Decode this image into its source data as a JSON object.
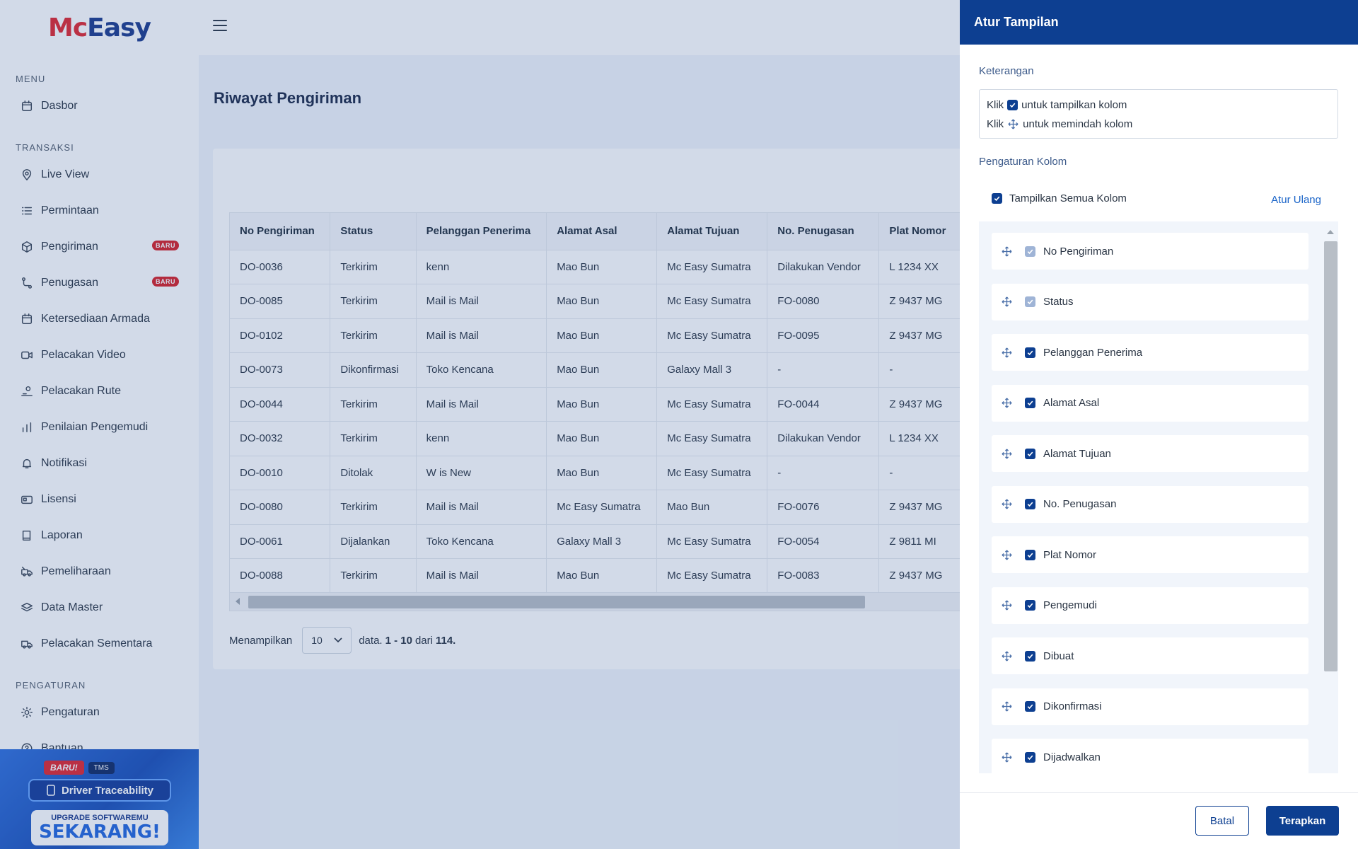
{
  "brand": {
    "logo_red": "Mc",
    "logo_blue": "Easy"
  },
  "sidebar": {
    "sections": [
      {
        "heading": "MENU",
        "items": [
          {
            "label": "Dasbor",
            "icon": "calendar-icon"
          }
        ]
      },
      {
        "heading": "TRANSAKSI",
        "items": [
          {
            "label": "Live View",
            "icon": "location-pin-icon"
          },
          {
            "label": "Permintaan",
            "icon": "list-icon"
          },
          {
            "label": "Pengiriman",
            "icon": "package-icon",
            "badge": "BARU"
          },
          {
            "label": "Penugasan",
            "icon": "route-icon",
            "badge": "BARU"
          },
          {
            "label": "Ketersediaan Armada",
            "icon": "calendar-icon"
          },
          {
            "label": "Pelacakan Video",
            "icon": "video-icon"
          },
          {
            "label": "Pelacakan Rute",
            "icon": "route-person-icon"
          },
          {
            "label": "Penilaian Pengemudi",
            "icon": "bar-chart-icon"
          },
          {
            "label": "Notifikasi",
            "icon": "bell-icon"
          },
          {
            "label": "Lisensi",
            "icon": "license-icon"
          },
          {
            "label": "Laporan",
            "icon": "book-icon"
          },
          {
            "label": "Pemeliharaan",
            "icon": "truck-wrench-icon"
          },
          {
            "label": "Data Master",
            "icon": "layers-icon"
          },
          {
            "label": "Pelacakan Sementara",
            "icon": "truck-icon"
          }
        ]
      },
      {
        "heading": "PENGATURAN",
        "items": [
          {
            "label": "Pengaturan",
            "icon": "gear-icon"
          },
          {
            "label": "Bantuan",
            "icon": "help-icon"
          }
        ]
      }
    ],
    "promo": {
      "badge": "BARU!",
      "tags": "TMS",
      "title": "Driver Traceability",
      "line1": "UPGRADE SOFTWAREMU",
      "line2": "SEKARANG!"
    }
  },
  "page": {
    "title": "Riwayat Pengiriman"
  },
  "table": {
    "columns": [
      "No Pengiriman",
      "Status",
      "Pelanggan Penerima",
      "Alamat Asal",
      "Alamat Tujuan",
      "No. Penugasan",
      "Plat Nomor"
    ],
    "rows": [
      [
        "DO-0036",
        "Terkirim",
        "kenn",
        "Mao Bun",
        "Mc Easy Sumatra",
        "Dilakukan Vendor",
        "L 1234 XX"
      ],
      [
        "DO-0085",
        "Terkirim",
        "Mail is Mail",
        "Mao Bun",
        "Mc Easy Sumatra",
        "FO-0080",
        "Z 9437 MG"
      ],
      [
        "DO-0102",
        "Terkirim",
        "Mail is Mail",
        "Mao Bun",
        "Mc Easy Sumatra",
        "FO-0095",
        "Z 9437 MG"
      ],
      [
        "DO-0073",
        "Dikonfirmasi",
        "Toko Kencana",
        "Mao Bun",
        "Galaxy Mall 3",
        "-",
        "-"
      ],
      [
        "DO-0044",
        "Terkirim",
        "Mail is Mail",
        "Mao Bun",
        "Mc Easy Sumatra",
        "FO-0044",
        "Z 9437 MG"
      ],
      [
        "DO-0032",
        "Terkirim",
        "kenn",
        "Mao Bun",
        "Mc Easy Sumatra",
        "Dilakukan Vendor",
        "L 1234 XX"
      ],
      [
        "DO-0010",
        "Ditolak",
        "W is New",
        "Mao Bun",
        "Mc Easy Sumatra",
        "-",
        "-"
      ],
      [
        "DO-0080",
        "Terkirim",
        "Mail is Mail",
        "Mc Easy Sumatra",
        "Mao Bun",
        "FO-0076",
        "Z 9437 MG"
      ],
      [
        "DO-0061",
        "Dijalankan",
        "Toko Kencana",
        "Galaxy Mall 3",
        "Mc Easy Sumatra",
        "FO-0054",
        "Z 9811 MI"
      ],
      [
        "DO-0088",
        "Terkirim",
        "Mail is Mail",
        "Mao Bun",
        "Mc Easy Sumatra",
        "FO-0083",
        "Z 9437 MG"
      ]
    ]
  },
  "pager": {
    "prefix": "Menampilkan",
    "page_size": "10",
    "suffix": "data.",
    "range": "1 - 10",
    "of_label": "dari",
    "total": "114."
  },
  "drawer": {
    "title": "Atur Tampilan",
    "info_label": "Keterangan",
    "info_click": "Klik",
    "info_line1": "untuk tampilkan kolom",
    "info_line2": "untuk memindah kolom",
    "settings_label": "Pengaturan Kolom",
    "show_all_label": "Tampilkan Semua Kolom",
    "reset_label": "Atur Ulang",
    "columns": [
      {
        "label": "No Pengiriman",
        "checked": true,
        "locked": true
      },
      {
        "label": "Status",
        "checked": true,
        "locked": true
      },
      {
        "label": "Pelanggan Penerima",
        "checked": true,
        "locked": false
      },
      {
        "label": "Alamat Asal",
        "checked": true,
        "locked": false
      },
      {
        "label": "Alamat Tujuan",
        "checked": true,
        "locked": false
      },
      {
        "label": "No. Penugasan",
        "checked": true,
        "locked": false
      },
      {
        "label": "Plat Nomor",
        "checked": true,
        "locked": false
      },
      {
        "label": "Pengemudi",
        "checked": true,
        "locked": false
      },
      {
        "label": "Dibuat",
        "checked": true,
        "locked": false
      },
      {
        "label": "Dikonfirmasi",
        "checked": true,
        "locked": false
      },
      {
        "label": "Dijadwalkan",
        "checked": true,
        "locked": false
      }
    ],
    "cancel_label": "Batal",
    "apply_label": "Terapkan"
  },
  "colors": {
    "primary": "#0d3f91",
    "brand_red": "#e0262d",
    "badge_red": "#d81f26",
    "link": "#1a64c8"
  }
}
